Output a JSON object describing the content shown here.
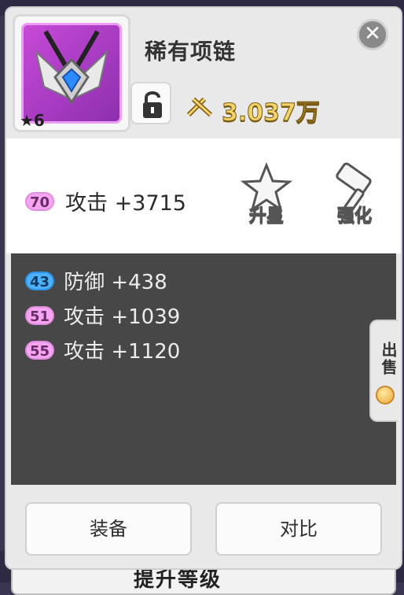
{
  "background": {
    "bottom_banner_text": "提升等级"
  },
  "item": {
    "name": "稀有项链",
    "star_text": "★6",
    "power_text": "3.037万",
    "icon": "necklace-icon",
    "frame_color": "#c64ad6"
  },
  "main_stat": {
    "level": "70",
    "text": "攻击 +3715"
  },
  "actions": {
    "star_up": "升星",
    "enhance": "强化"
  },
  "sub_stats": [
    {
      "level": "43",
      "text": "防御 +438",
      "color": "#4fb0ff"
    },
    {
      "level": "51",
      "text": "攻击 +1039",
      "color": "#f6a6f1"
    },
    {
      "level": "55",
      "text": "攻击 +1120",
      "color": "#f6a6f1"
    }
  ],
  "sell": {
    "label": "出售"
  },
  "buttons": {
    "equip": "装备",
    "compare": "对比"
  }
}
